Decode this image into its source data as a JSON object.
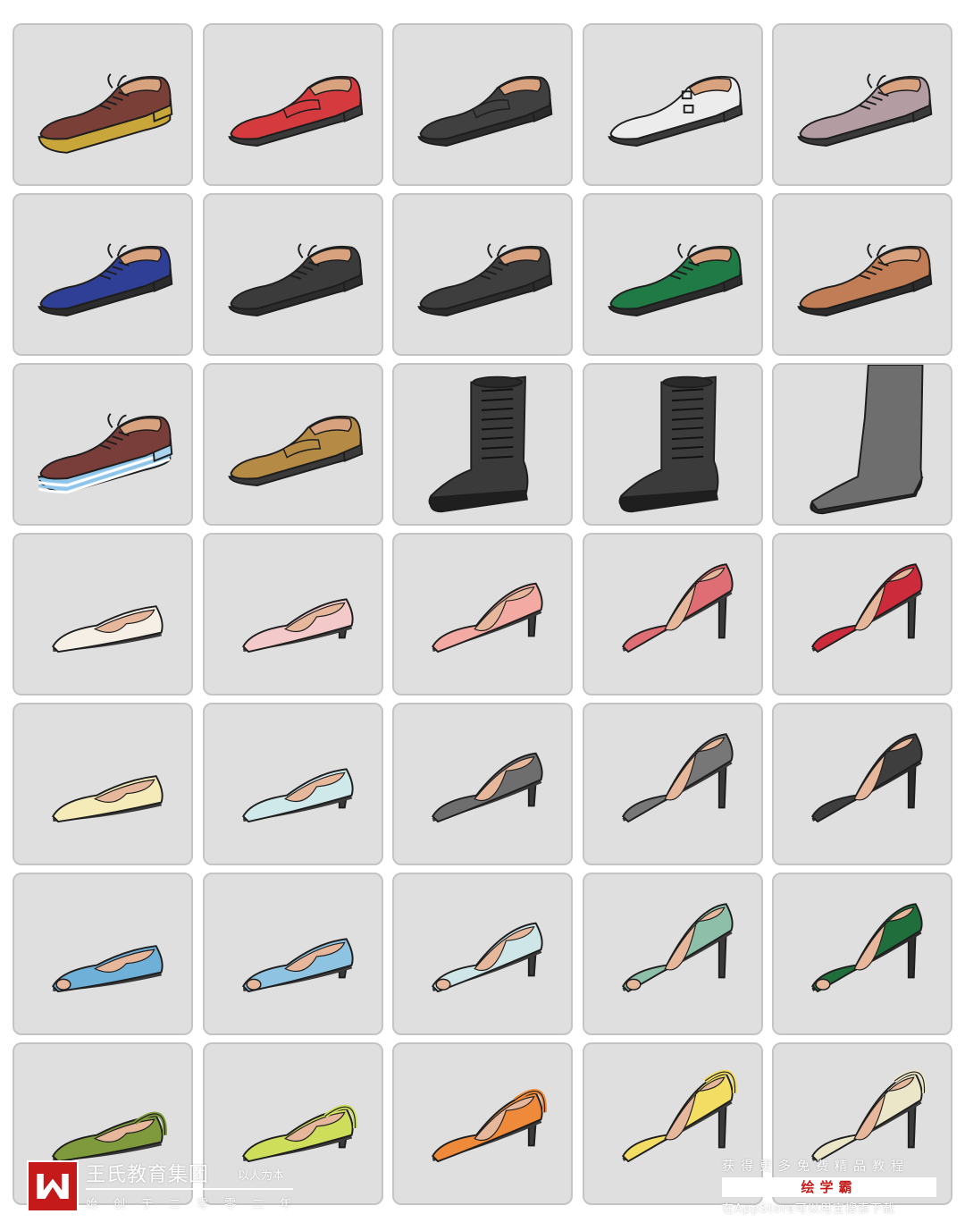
{
  "shoes": [
    {
      "style": "derby-platform",
      "color": "#7a4038",
      "sole": "#c9a63a"
    },
    {
      "style": "loafer",
      "color": "#d43a3e",
      "sole": "#3a3a3a"
    },
    {
      "style": "loafer",
      "color": "#404040",
      "sole": "#2c2c2c"
    },
    {
      "style": "monk",
      "color": "#ececec",
      "sole": "#3a3a3a"
    },
    {
      "style": "brogue",
      "color": "#b49ca3",
      "sole": "#3a3a3a"
    },
    {
      "style": "oxford",
      "color": "#2f3f95",
      "sole": "#2c2c2c"
    },
    {
      "style": "oxford",
      "color": "#3b3b3b",
      "sole": "#2c2c2c"
    },
    {
      "style": "oxford",
      "color": "#3e3e3e",
      "sole": "#2c2c2c"
    },
    {
      "style": "oxford",
      "color": "#1f7a45",
      "sole": "#2c2c2c"
    },
    {
      "style": "oxford",
      "color": "#c17d55",
      "sole": "#2c2c2c"
    },
    {
      "style": "creeper",
      "color": "#7a3e3a",
      "sole": "#a9d3ee"
    },
    {
      "style": "loafer",
      "color": "#b58a45",
      "sole": "#3a3a3a"
    },
    {
      "style": "combat-boot",
      "color": "#3a3a3a",
      "sole": "#1f1f1f"
    },
    {
      "style": "lace-boot",
      "color": "#3b3b3b",
      "sole": "#1f1f1f"
    },
    {
      "style": "tall-boot",
      "color": "#6e6e6e",
      "sole": "#2c2c2c"
    },
    {
      "style": "flat",
      "color": "#f6efe6",
      "sole": "#3a3a3a"
    },
    {
      "style": "low-heel",
      "color": "#f3c9c9",
      "sole": "#3a3a3a"
    },
    {
      "style": "mid-heel",
      "color": "#f2aaa2",
      "sole": "#3a3a3a"
    },
    {
      "style": "high-heel",
      "color": "#df6e74",
      "sole": "#3a3a3a"
    },
    {
      "style": "high-heel",
      "color": "#cc2b3c",
      "sole": "#3a3a3a"
    },
    {
      "style": "flat",
      "color": "#f4ebb8",
      "sole": "#3a3a3a"
    },
    {
      "style": "low-heel",
      "color": "#cfe8ea",
      "sole": "#3a3a3a"
    },
    {
      "style": "mid-heel",
      "color": "#6e6e6e",
      "sole": "#3a3a3a"
    },
    {
      "style": "high-heel",
      "color": "#777777",
      "sole": "#3a3a3a"
    },
    {
      "style": "high-heel",
      "color": "#3e3e3e",
      "sole": "#2c2c2c"
    },
    {
      "style": "peep-flat",
      "color": "#6fb0d9",
      "sole": "#3a3a3a"
    },
    {
      "style": "peep-low",
      "color": "#8ec3e1",
      "sole": "#3a3a3a"
    },
    {
      "style": "peep-mid",
      "color": "#cfe6e8",
      "sole": "#3a3a3a"
    },
    {
      "style": "peep-high",
      "color": "#8dbfa9",
      "sole": "#3a3a3a"
    },
    {
      "style": "peep-high",
      "color": "#1f6e3c",
      "sole": "#2c2c2c"
    },
    {
      "style": "slingback-flat",
      "color": "#7f9a3c",
      "sole": "#3a3a3a"
    },
    {
      "style": "slingback-low",
      "color": "#cede5a",
      "sole": "#3a3a3a"
    },
    {
      "style": "slingback-mid",
      "color": "#ef8a3a",
      "sole": "#3a3a3a"
    },
    {
      "style": "slingback-high",
      "color": "#f3dd62",
      "sole": "#3a3a3a"
    },
    {
      "style": "slingback-high",
      "color": "#ece6c8",
      "sole": "#3a3a3a"
    }
  ],
  "watermark": {
    "brand": "王氏教育集团",
    "slogan": "以人为本",
    "tagline": "始创于二零零二年",
    "promo": "获得更多免费精品教程",
    "app_name": "绘学霸",
    "store_text": "在AppStore可以用宝搜索下载"
  }
}
